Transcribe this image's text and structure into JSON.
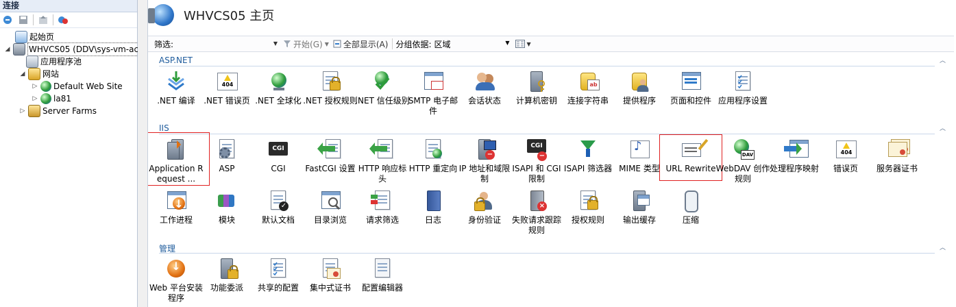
{
  "connections": {
    "title": "连接",
    "tree": [
      {
        "label": "起始页",
        "indent": 0
      },
      {
        "label": "WHVCS05 (DDV\\sys-vm-ac",
        "indent": 0
      },
      {
        "label": "应用程序池",
        "indent": 1
      },
      {
        "label": "网站",
        "indent": 1
      },
      {
        "label": "Default Web Site",
        "indent": 2
      },
      {
        "label": "la81",
        "indent": 2
      },
      {
        "label": "Server Farms",
        "indent": 1
      }
    ]
  },
  "header": {
    "title": "WHVCS05 主页"
  },
  "filterbar": {
    "filter_label": "筛选:",
    "go_label": "开始(G)",
    "show_all_label": "全部显示(A)",
    "group_by_label": "分组依据:",
    "group_by_value": "区域"
  },
  "groups": {
    "aspnet": {
      "title": "ASP.NET",
      "items": [
        {
          "label": ".NET 编译",
          "icon": "download-icon"
        },
        {
          "label": ".NET 错误页",
          "icon": "error-page-icon"
        },
        {
          "label": ".NET 全球化",
          "icon": "globe-icon"
        },
        {
          "label": ".NET 授权规则",
          "icon": "authorization-icon"
        },
        {
          "label": ".NET 信任级别",
          "icon": "trust-level-icon"
        },
        {
          "label": "SMTP 电子邮件",
          "icon": "email-icon"
        },
        {
          "label": "会话状态",
          "icon": "session-state-icon"
        },
        {
          "label": "计算机密钥",
          "icon": "machine-key-icon"
        },
        {
          "label": "连接字符串",
          "icon": "connection-string-icon"
        },
        {
          "label": "提供程序",
          "icon": "providers-icon"
        },
        {
          "label": "页面和控件",
          "icon": "pages-controls-icon"
        },
        {
          "label": "应用程序设置",
          "icon": "app-settings-icon"
        }
      ]
    },
    "iis": {
      "title": "IIS",
      "items": [
        {
          "label": "Application Request ...",
          "icon": "arr-icon"
        },
        {
          "label": "ASP",
          "icon": "asp-icon"
        },
        {
          "label": "CGI",
          "icon": "cgi-icon"
        },
        {
          "label": "FastCGI 设置",
          "icon": "fastcgi-icon"
        },
        {
          "label": "HTTP 响应标头",
          "icon": "http-headers-icon"
        },
        {
          "label": "HTTP 重定向",
          "icon": "http-redirect-icon"
        },
        {
          "label": "IP 地址和域限制",
          "icon": "ip-restrictions-icon"
        },
        {
          "label": "ISAPI 和 CGI 限制",
          "icon": "isapi-cgi-icon"
        },
        {
          "label": "ISAPI 筛选器",
          "icon": "isapi-filter-icon"
        },
        {
          "label": "MIME 类型",
          "icon": "mime-icon"
        },
        {
          "label": "URL Rewrite",
          "icon": "url-rewrite-icon"
        },
        {
          "label": "WebDAV 创作规则",
          "icon": "webdav-icon"
        },
        {
          "label": "处理程序映射",
          "icon": "handler-mapping-icon"
        },
        {
          "label": "错误页",
          "icon": "error-pages-icon"
        },
        {
          "label": "服务器证书",
          "icon": "server-cert-icon"
        },
        {
          "label": "工作进程",
          "icon": "worker-process-icon"
        },
        {
          "label": "模块",
          "icon": "modules-icon"
        },
        {
          "label": "默认文档",
          "icon": "default-doc-icon"
        },
        {
          "label": "目录浏览",
          "icon": "dir-browsing-icon"
        },
        {
          "label": "请求筛选",
          "icon": "request-filter-icon"
        },
        {
          "label": "日志",
          "icon": "logging-icon"
        },
        {
          "label": "身份验证",
          "icon": "authentication-icon"
        },
        {
          "label": "失败请求跟踪规则",
          "icon": "failed-request-icon"
        },
        {
          "label": "授权规则",
          "icon": "auth-rules-icon"
        },
        {
          "label": "输出缓存",
          "icon": "output-cache-icon"
        },
        {
          "label": "压缩",
          "icon": "compression-icon"
        }
      ]
    },
    "management": {
      "title": "管理",
      "items": [
        {
          "label": "Web 平台安装程序",
          "icon": "web-platform-icon"
        },
        {
          "label": "功能委派",
          "icon": "feature-delegation-icon"
        },
        {
          "label": "共享的配置",
          "icon": "shared-config-icon"
        },
        {
          "label": "集中式证书",
          "icon": "central-cert-icon"
        },
        {
          "label": "配置编辑器",
          "icon": "config-editor-icon"
        }
      ]
    }
  }
}
